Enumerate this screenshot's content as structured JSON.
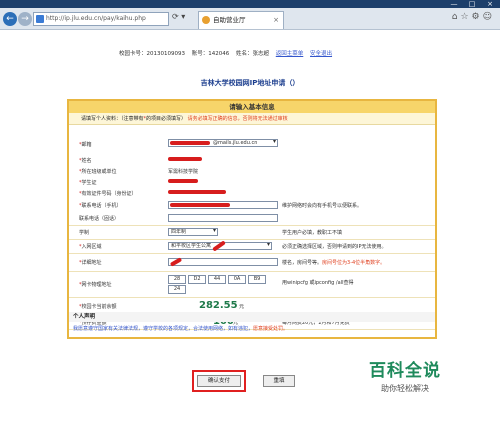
{
  "browser": {
    "url": "http://ip.jlu.edu.cn/pay/kaihu.php",
    "tab_title": "自助营业厅",
    "tab_close": "×",
    "back_icon": "back-arrow",
    "forward_icon": "forward-arrow",
    "window_controls": [
      "—",
      "□",
      "×"
    ]
  },
  "user_info": {
    "card_no": "校园卡号：20130109093",
    "account": "账号：142046",
    "name": "姓名：张志超",
    "home_link": "返回主菜单",
    "logout_link": "安全退出"
  },
  "page_title": "吉林大学校园网IP地址申请（）",
  "form": {
    "header": "请输入基本信息",
    "note_prefix": "请填写个人资料：（注意带有",
    "note_mid": "的项目必须填写）",
    "note_red": "请务必填写正确的信息，否则将无法通过审核",
    "fields": {
      "email_label": "邮箱",
      "email_value": "@mails.jlu.edu.cn",
      "name_label": "姓名",
      "college_label": "所在班级或单位",
      "college_value": "军需科技学院",
      "student_no_label": "学生证",
      "id_label": "有效证件号码（身份证）",
      "mobile_label": "联系电话（手机）",
      "mobile_hint": "维护网络时会向有手机号以便联系。",
      "landline_label": "联系电话（固话）",
      "school_label": "学制",
      "school_value": "四年制",
      "school_hint": "学生用户必填，教职工不填",
      "area_label": "入网区域",
      "area_value": "和平校区学生公寓",
      "area_hint": "必须正确选择区域，否则申请到的IP无法使用。",
      "address_label": "详细地址",
      "address_hint_prefix": "楼名，房间号等。",
      "address_hint_red": "房间号位为3-4位半角数字。",
      "mac_label": "网卡物理地址",
      "mac_values": [
        "28",
        "D2",
        "44",
        "0A",
        "B9",
        "24"
      ],
      "mac_hint": "用winipcfg 或ipconfig /all查得",
      "balance_label": "校园卡当前余额",
      "balance_value": "282.55",
      "balance_unit": "元",
      "fee_label": "预存费金额",
      "fee_value": "100",
      "fee_unit": "元",
      "fee_hint": "每月网费20元，2月和7月免费"
    },
    "declaration_title": "个人声明",
    "declaration_text": "我愿意遵守国家有关法律法规，遵守学校的各项规定，合法使用网络，如有违犯，",
    "declaration_red": "愿意接受处罚。"
  },
  "buttons": {
    "pay": "确认支付",
    "reset": "重填"
  },
  "watermark": {
    "title": "百科全说",
    "subtitle": "助你轻松解决"
  },
  "colors": {
    "accent_yellow": "#f7d56a",
    "form_border": "#e8b640",
    "link_blue": "#3355cc",
    "amount_green": "#1f7a4a",
    "highlight_red": "#e02020"
  }
}
